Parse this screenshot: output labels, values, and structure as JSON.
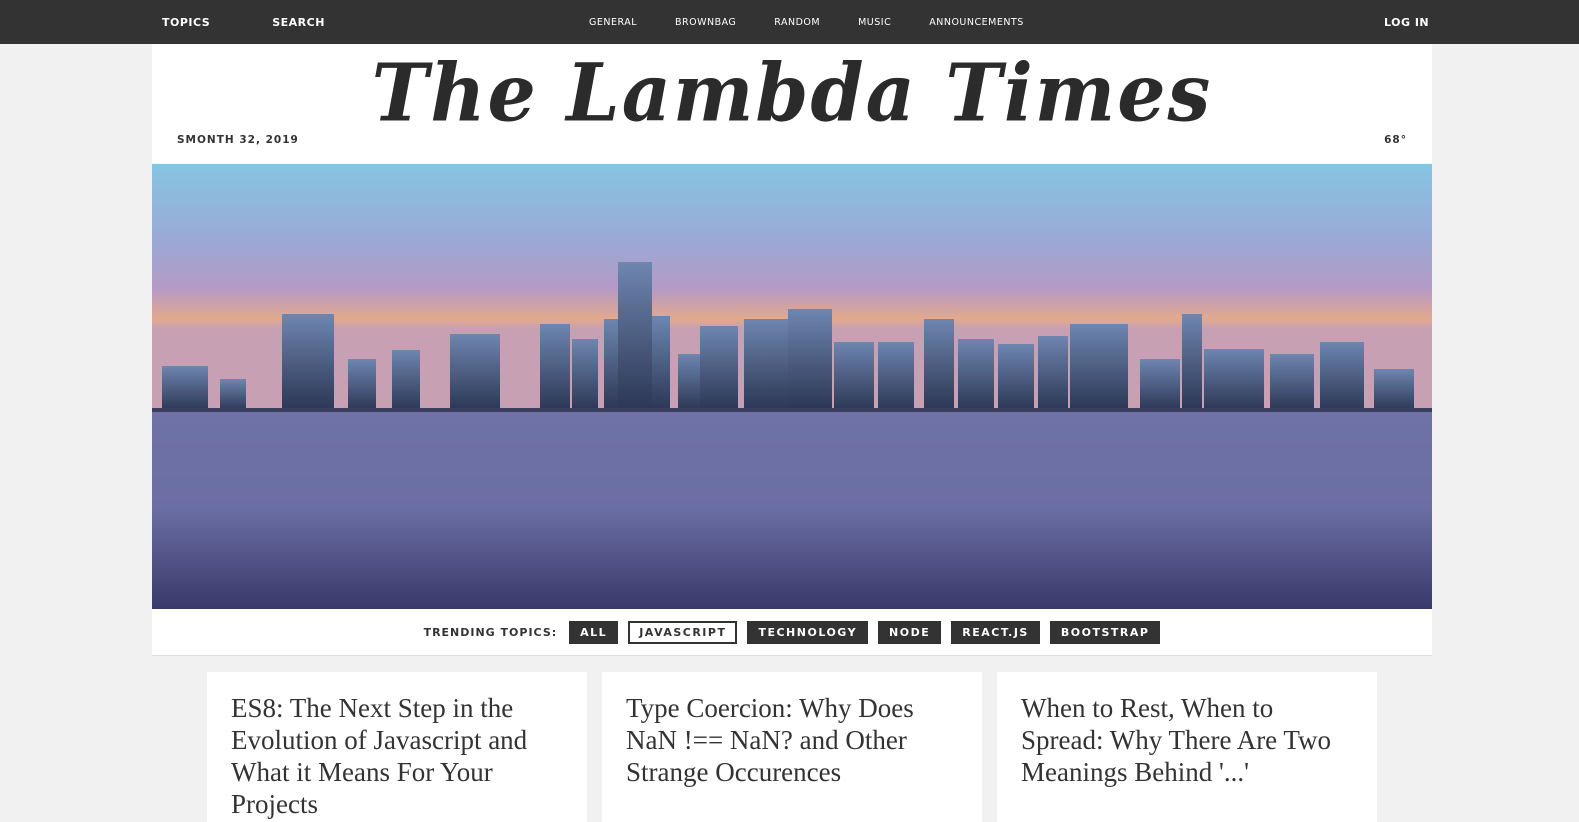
{
  "nav": {
    "left": [
      "TOPICS",
      "SEARCH"
    ],
    "center": [
      "GENERAL",
      "BROWNBAG",
      "RANDOM",
      "MUSIC",
      "ANNOUNCEMENTS"
    ],
    "login": "LOG IN"
  },
  "header": {
    "title": "The Lambda Times",
    "date": "SMONTH 32, 2019",
    "temperature": "68°"
  },
  "trending": {
    "label": "TRENDING TOPICS:",
    "tabs": [
      "ALL",
      "JAVASCRIPT",
      "TECHNOLOGY",
      "NODE",
      "REACT.JS",
      "BOOTSTRAP"
    ],
    "active": "JAVASCRIPT"
  },
  "cards": [
    {
      "headline": "ES8: The Next Step in the Evolution of Javascript and What it Means For Your Projects"
    },
    {
      "headline": "Type Coercion: Why Does NaN !== NaN? and Other Strange Occurences"
    },
    {
      "headline": "When to Rest, When to Spread: Why There Are Two Meanings Behind '...'"
    }
  ],
  "colors": {
    "nav_bg": "#333333",
    "page_bg": "#f1f1f1",
    "tab_bg": "#333333"
  }
}
